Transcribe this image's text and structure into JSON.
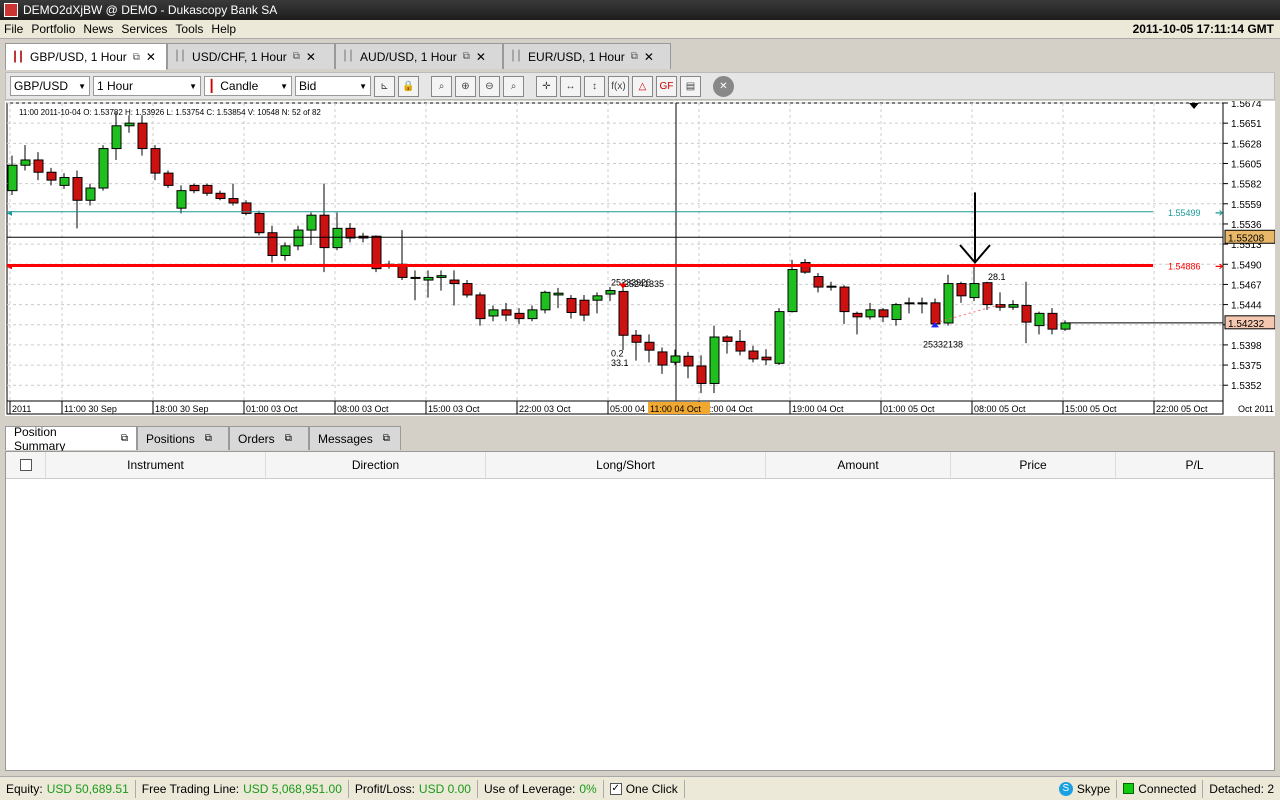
{
  "window": {
    "title": "DEMO2dXjBW @ DEMO - Dukascopy Bank SA"
  },
  "menu": {
    "items": [
      "File",
      "Portfolio",
      "News",
      "Services",
      "Tools",
      "Help"
    ],
    "clock": "2011-10-05 17:11:14 GMT"
  },
  "tabs": [
    {
      "label": "GBP/USD,  1 Hour",
      "active": true
    },
    {
      "label": "USD/CHF,  1 Hour"
    },
    {
      "label": "AUD/USD,  1 Hour"
    },
    {
      "label": "EUR/USD,  1 Hour"
    }
  ],
  "toolbar": {
    "instrument": "GBP/USD",
    "period": "1 Hour",
    "chart_type": "Candle",
    "side": "Bid"
  },
  "colors": {
    "up": "#1fbf1f",
    "down": "#cc1111",
    "teal": "#1a9a9a",
    "red_line": "#ff0000"
  },
  "chart_data": {
    "type": "candlestick",
    "info": "11:00 2011-10-04   O: 1.53782   H: 1.53926   L: 1.53754   C: 1.53854   V: 10548   N: 52 of 82",
    "ylim": [
      1.5334,
      1.5674
    ],
    "yticks": [
      "1.5674",
      "1.5651",
      "1.5628",
      "1.5605",
      "1.5582",
      "1.5559",
      "1.5536",
      "1.5513",
      "1.5490",
      "1.5467",
      "1.5444",
      "1.5421",
      "1.5398",
      "1.5375",
      "1.5352"
    ],
    "xticks": [
      {
        "i": 0,
        "label": "2011"
      },
      {
        "i": 4,
        "label": "11:00 30 Sep"
      },
      {
        "i": 11,
        "label": "18:00 30 Sep"
      },
      {
        "i": 18,
        "label": "01:00 03 Oct"
      },
      {
        "i": 25,
        "label": "08:00 03 Oct"
      },
      {
        "i": 32,
        "label": "15:00 03 Oct"
      },
      {
        "i": 39,
        "label": "22:00 03 Oct"
      },
      {
        "i": 46,
        "label": "05:00 04 Oct"
      },
      {
        "i": 53,
        "label": "12:00 04 Oct"
      },
      {
        "i": 60,
        "label": "19:00 04 Oct"
      },
      {
        "i": 67,
        "label": "01:00 05 Oct"
      },
      {
        "i": 74,
        "label": "08:00 05 Oct"
      },
      {
        "i": 81,
        "label": "15:00 05 Oct"
      },
      {
        "i": 88,
        "label": "22:00 05 Oct"
      }
    ],
    "xlabel_right": "Oct 2011",
    "cursor": {
      "i": 51,
      "label": "11:00 04 Oct"
    },
    "candles": [
      [
        1.5574,
        1.5614,
        1.5569,
        1.5603
      ],
      [
        1.5603,
        1.5626,
        1.5597,
        1.5609
      ],
      [
        1.5609,
        1.5618,
        1.5586,
        1.5595
      ],
      [
        1.5595,
        1.56,
        1.558,
        1.5586
      ],
      [
        1.558,
        1.5594,
        1.5576,
        1.5589
      ],
      [
        1.5589,
        1.5597,
        1.5531,
        1.5563
      ],
      [
        1.5563,
        1.5582,
        1.5557,
        1.5577
      ],
      [
        1.5577,
        1.5626,
        1.5574,
        1.5622
      ],
      [
        1.5622,
        1.5663,
        1.5609,
        1.5648
      ],
      [
        1.5648,
        1.566,
        1.564,
        1.5651
      ],
      [
        1.5651,
        1.566,
        1.5614,
        1.5622
      ],
      [
        1.5622,
        1.5626,
        1.5586,
        1.5594
      ],
      [
        1.5594,
        1.5597,
        1.5577,
        1.558
      ],
      [
        1.5554,
        1.558,
        1.5548,
        1.5574
      ],
      [
        1.558,
        1.5582,
        1.5571,
        1.5574
      ],
      [
        1.558,
        1.5582,
        1.5568,
        1.5571
      ],
      [
        1.5571,
        1.5574,
        1.5563,
        1.5565
      ],
      [
        1.5565,
        1.5582,
        1.5557,
        1.556
      ],
      [
        1.556,
        1.5563,
        1.5546,
        1.5548
      ],
      [
        1.5548,
        1.5551,
        1.5523,
        1.5526
      ],
      [
        1.5526,
        1.5534,
        1.5492,
        1.55
      ],
      [
        1.55,
        1.5515,
        1.5494,
        1.5511
      ],
      [
        1.5511,
        1.5534,
        1.5506,
        1.5529
      ],
      [
        1.5529,
        1.5549,
        1.5512,
        1.5546
      ],
      [
        1.5546,
        1.5582,
        1.5481,
        1.5509
      ],
      [
        1.5509,
        1.5549,
        1.5506,
        1.5531
      ],
      [
        1.5531,
        1.5537,
        1.5515,
        1.552
      ],
      [
        1.5522,
        1.5526,
        1.5515,
        1.552
      ],
      [
        1.5522,
        1.5523,
        1.5481,
        1.5485
      ],
      [
        1.549,
        1.5494,
        1.5485,
        1.5488
      ],
      [
        1.549,
        1.5529,
        1.5472,
        1.5475
      ],
      [
        1.5475,
        1.5483,
        1.5449,
        1.5474
      ],
      [
        1.5472,
        1.5483,
        1.5452,
        1.5475
      ],
      [
        1.5475,
        1.5483,
        1.546,
        1.5477
      ],
      [
        1.5472,
        1.5483,
        1.5443,
        1.5468
      ],
      [
        1.5468,
        1.5472,
        1.5452,
        1.5455
      ],
      [
        1.5455,
        1.5458,
        1.542,
        1.5428
      ],
      [
        1.5431,
        1.5443,
        1.5425,
        1.5438
      ],
      [
        1.5438,
        1.5446,
        1.5425,
        1.5432
      ],
      [
        1.5434,
        1.544,
        1.5422,
        1.5428
      ],
      [
        1.5428,
        1.5443,
        1.5425,
        1.5438
      ],
      [
        1.5438,
        1.546,
        1.5434,
        1.5458
      ],
      [
        1.5455,
        1.5463,
        1.544,
        1.5457
      ],
      [
        1.5451,
        1.5455,
        1.5428,
        1.5435
      ],
      [
        1.5449,
        1.5455,
        1.5425,
        1.5432
      ],
      [
        1.5449,
        1.5458,
        1.5434,
        1.5454
      ],
      [
        1.5456,
        1.5464,
        1.5448,
        1.546
      ],
      [
        1.5459,
        1.547,
        1.5392,
        1.5409
      ],
      [
        1.5409,
        1.5415,
        1.538,
        1.5401
      ],
      [
        1.5401,
        1.541,
        1.5378,
        1.5392
      ],
      [
        1.539,
        1.5395,
        1.5365,
        1.5375
      ],
      [
        1.53782,
        1.53926,
        1.53754,
        1.53854
      ],
      [
        1.5385,
        1.539,
        1.536,
        1.5374
      ],
      [
        1.5374,
        1.5386,
        1.5343,
        1.5354
      ],
      [
        1.5354,
        1.542,
        1.5343,
        1.5407
      ],
      [
        1.5407,
        1.5409,
        1.5388,
        1.5402
      ],
      [
        1.5402,
        1.5415,
        1.5386,
        1.5391
      ],
      [
        1.5391,
        1.5397,
        1.5378,
        1.5382
      ],
      [
        1.5384,
        1.5393,
        1.5375,
        1.5381
      ],
      [
        1.5377,
        1.544,
        1.5375,
        1.5436
      ],
      [
        1.5436,
        1.5495,
        1.5435,
        1.5484
      ],
      [
        1.5492,
        1.5496,
        1.5479,
        1.5481
      ],
      [
        1.5476,
        1.548,
        1.5458,
        1.5464
      ],
      [
        1.5465,
        1.547,
        1.546,
        1.5464
      ],
      [
        1.5464,
        1.5466,
        1.5422,
        1.5436
      ],
      [
        1.5434,
        1.5436,
        1.541,
        1.543
      ],
      [
        1.543,
        1.5446,
        1.5427,
        1.5438
      ],
      [
        1.5438,
        1.544,
        1.5424,
        1.543
      ],
      [
        1.5427,
        1.5446,
        1.542,
        1.5444
      ],
      [
        1.5446,
        1.5452,
        1.5434,
        1.5446
      ],
      [
        1.5446,
        1.5452,
        1.5434,
        1.5446
      ],
      [
        1.5446,
        1.5451,
        1.5418,
        1.5422
      ],
      [
        1.5423,
        1.5478,
        1.542,
        1.5468
      ],
      [
        1.5468,
        1.547,
        1.5446,
        1.5454
      ],
      [
        1.5452,
        1.549,
        1.5448,
        1.5468
      ],
      [
        1.5469,
        1.547,
        1.5438,
        1.5444
      ],
      [
        1.5444,
        1.5458,
        1.5437,
        1.5441
      ],
      [
        1.5441,
        1.5449,
        1.5438,
        1.5444
      ],
      [
        1.5443,
        1.547,
        1.54,
        1.5424
      ],
      [
        1.542,
        1.5436,
        1.541,
        1.5434
      ],
      [
        1.5434,
        1.544,
        1.541,
        1.5416
      ],
      [
        1.5416,
        1.5426,
        1.5414,
        1.5423
      ]
    ],
    "lines": [
      {
        "price": 1.55499,
        "label": "1.55499",
        "color": "#1a9a9a",
        "kind": "alert"
      },
      {
        "price": 1.55208,
        "label": "1.55208",
        "color": "#000000",
        "kind": "level"
      },
      {
        "price": 1.54886,
        "label": "1.54886",
        "color": "#ff0000",
        "kind": "alert"
      },
      {
        "price": 1.54232,
        "label": "1.54232",
        "color": "#000000",
        "kind": "current"
      }
    ],
    "annotations": [
      {
        "i": 47,
        "price": 1.5466,
        "text": "25233926"
      },
      {
        "i": 48,
        "price": 1.5464,
        "text": "25241335"
      },
      {
        "i": 47,
        "price": 1.5385,
        "text": "0.2"
      },
      {
        "i": 47,
        "price": 1.5374,
        "text": "33.1"
      },
      {
        "i": 71,
        "price": 1.5395,
        "text": "25332138"
      },
      {
        "i": 76,
        "price": 1.5472,
        "text": "28.1"
      }
    ]
  },
  "bottom_tabs": [
    "Position Summary",
    "Positions",
    "Orders",
    "Messages"
  ],
  "table": {
    "columns": [
      "Instrument",
      "Direction",
      "Long/Short",
      "Amount",
      "Price",
      "P/L"
    ]
  },
  "status": {
    "equity_label": "Equity:",
    "equity": "USD 50,689.51",
    "ftl_label": "Free Trading Line:",
    "ftl": "USD 5,068,951.00",
    "pl_label": "Profit/Loss:",
    "pl": "USD 0.00",
    "lev_label": "Use of Leverage:",
    "lev": "0%",
    "one_click": "One Click",
    "skype": "Skype",
    "connected": "Connected",
    "detached": "Detached: 2"
  }
}
